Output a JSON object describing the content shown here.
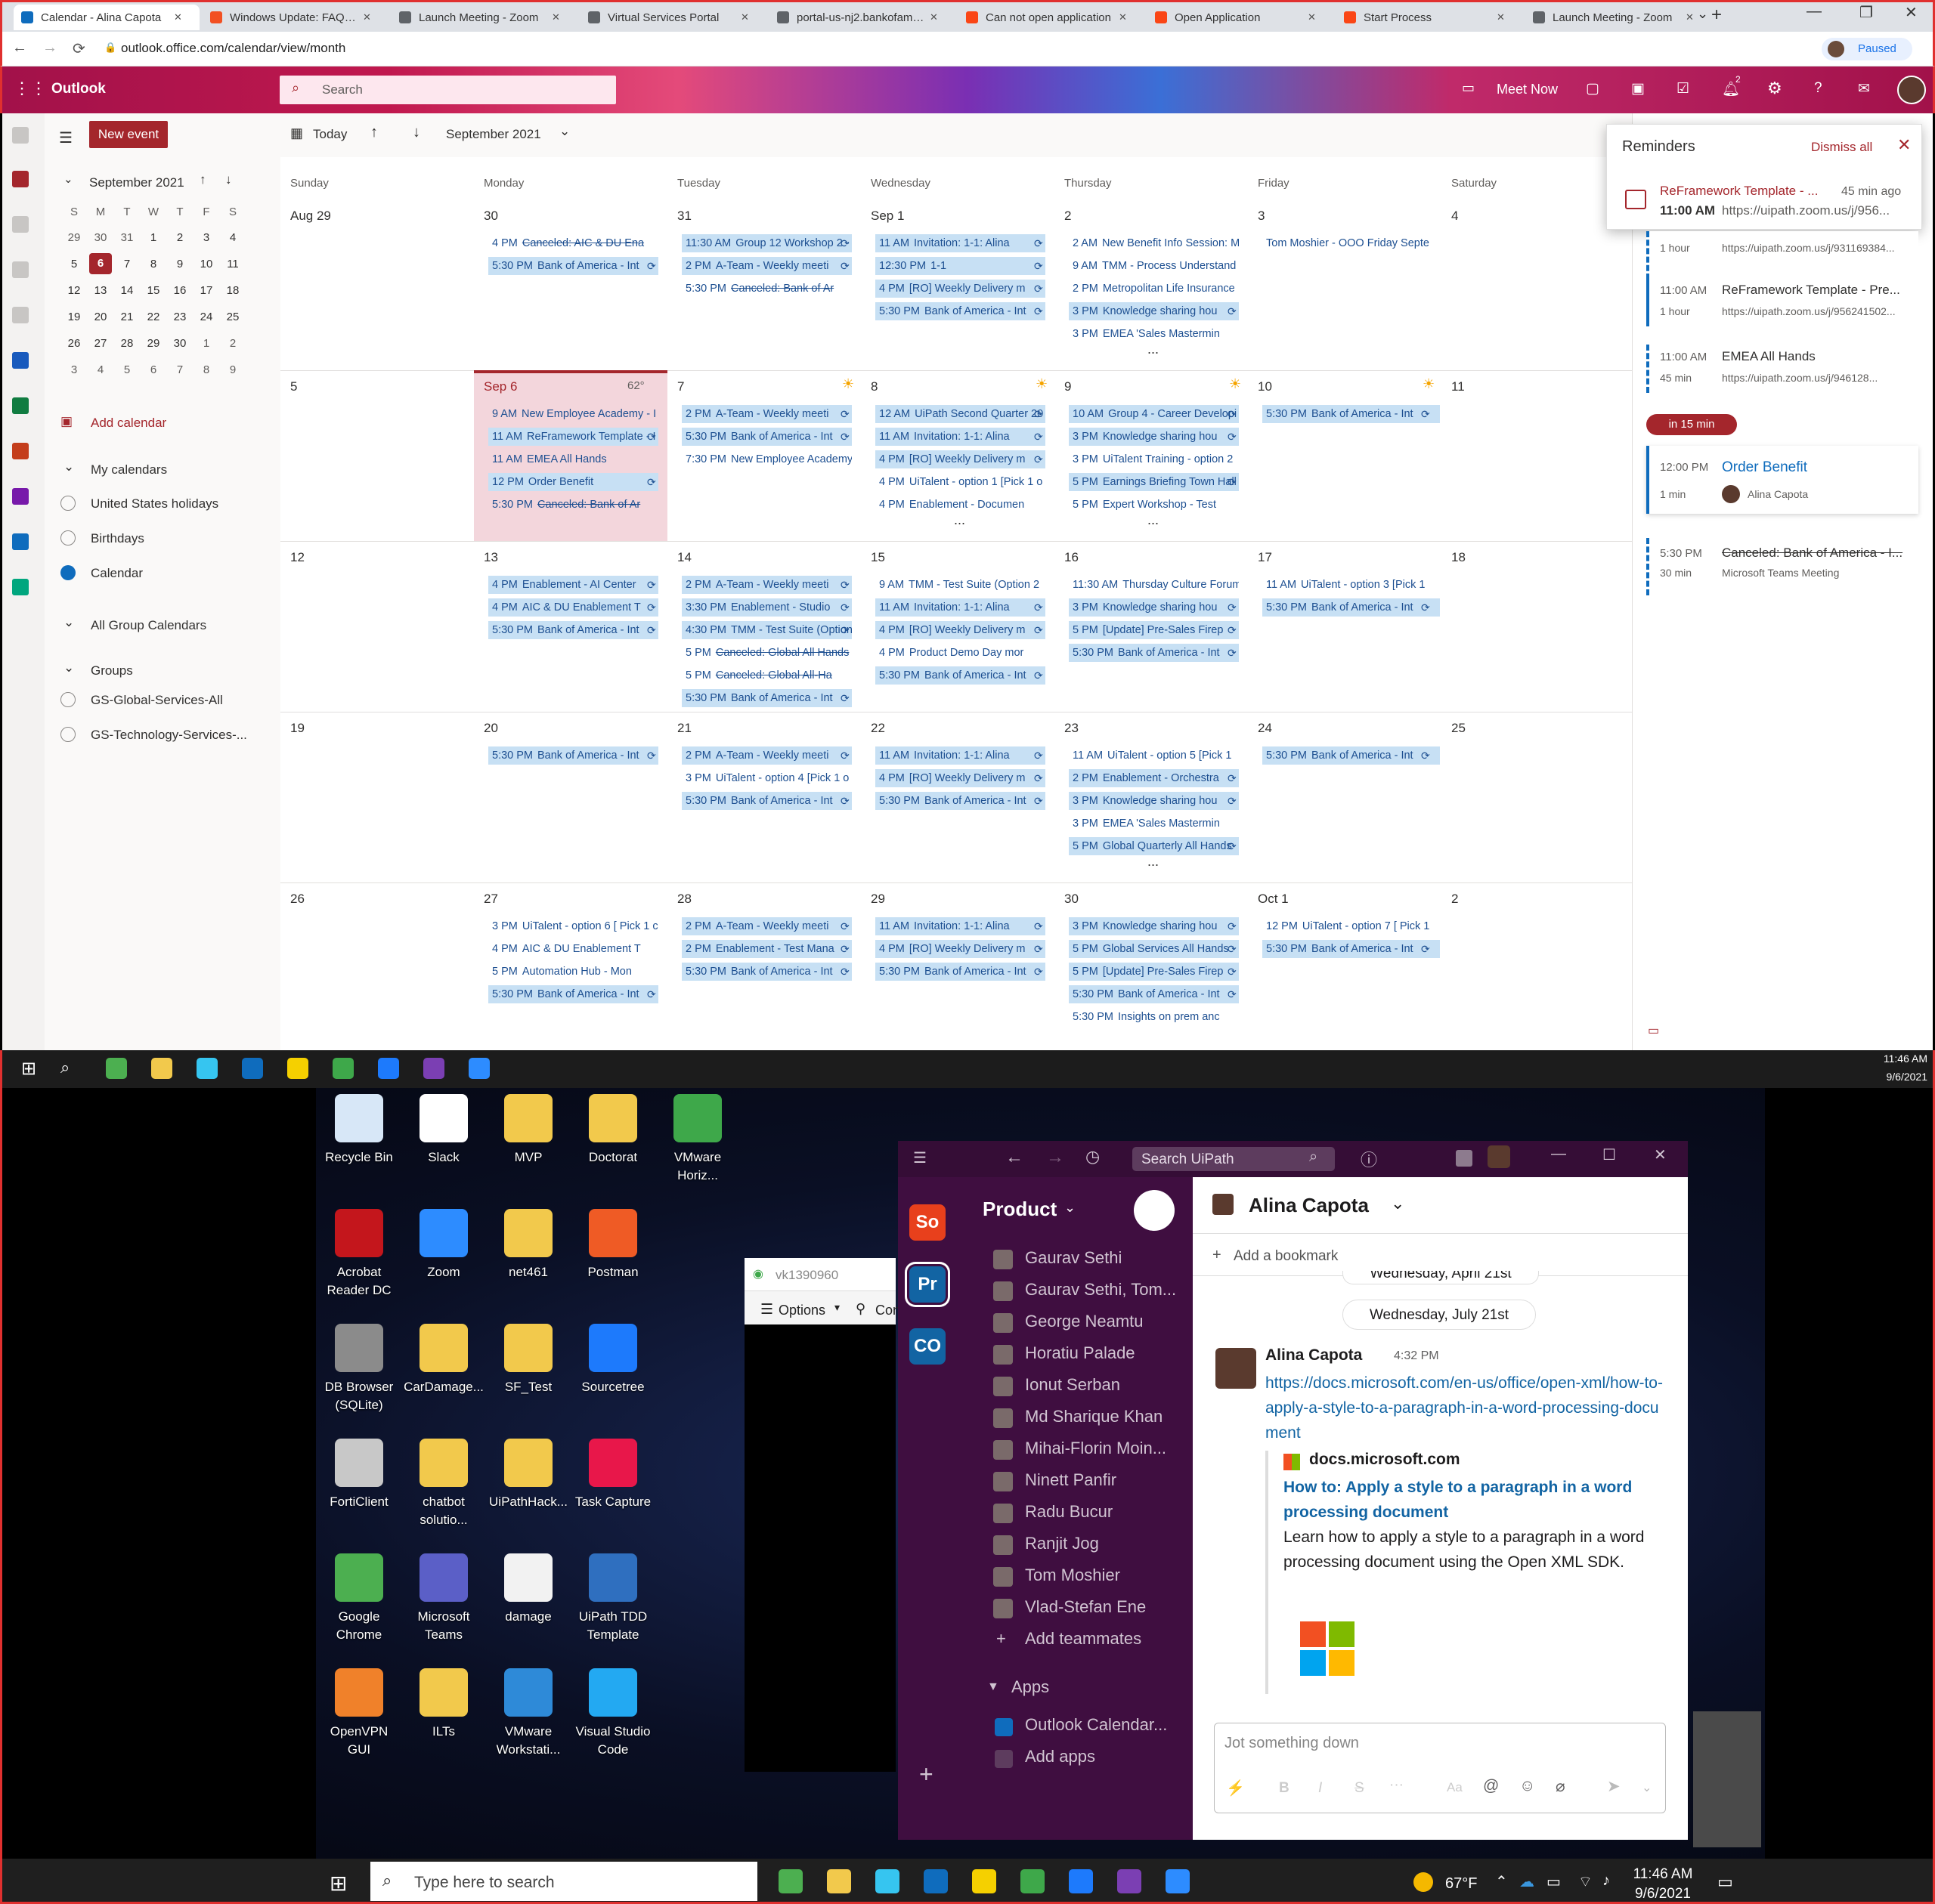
{
  "browser": {
    "tabs": [
      {
        "label": "Calendar - Alina Capota",
        "color": "#0f6cbd"
      },
      {
        "label": "Windows Update: FAQ - Windows",
        "color": "#f25022"
      },
      {
        "label": "Launch Meeting - Zoom",
        "color": "#5f6368"
      },
      {
        "label": "Virtual Services Portal",
        "color": "#5f6368"
      },
      {
        "label": "portal-us-nj2.bankofamerica",
        "color": "#5f6368"
      },
      {
        "label": "Can not open application",
        "color": "#fa4616"
      },
      {
        "label": "Open Application",
        "color": "#fa4616"
      },
      {
        "label": "Start Process",
        "color": "#fa4616"
      },
      {
        "label": "Launch Meeting - Zoom",
        "color": "#5f6368"
      }
    ],
    "url": "outlook.office.com/calendar/view/month",
    "profile_label": "Paused"
  },
  "outlook": {
    "app_name": "Outlook",
    "search_placeholder": "Search",
    "meet_now": "Meet Now",
    "badge_count": "2",
    "new_event": "New event",
    "today": "Today",
    "month_label": "September 2021",
    "accent": "#a4262c"
  },
  "nav": {
    "mini_month": "September 2021",
    "weekday_initials": [
      "S",
      "M",
      "T",
      "W",
      "T",
      "F",
      "S"
    ],
    "weeks": [
      [
        "29",
        "30",
        "31",
        "1",
        "2",
        "3",
        "4"
      ],
      [
        "5",
        "6",
        "7",
        "8",
        "9",
        "10",
        "11"
      ],
      [
        "12",
        "13",
        "14",
        "15",
        "16",
        "17",
        "18"
      ],
      [
        "19",
        "20",
        "21",
        "22",
        "23",
        "24",
        "25"
      ],
      [
        "26",
        "27",
        "28",
        "29",
        "30",
        "1",
        "2"
      ],
      [
        "3",
        "4",
        "5",
        "6",
        "7",
        "8",
        "9"
      ]
    ],
    "add_calendar": "Add calendar",
    "my_calendars": "My calendars",
    "calendars": [
      {
        "label": "United States holidays",
        "checked": false
      },
      {
        "label": "Birthdays",
        "checked": false
      },
      {
        "label": "Calendar",
        "checked": true
      }
    ],
    "all_group": "All Group Calendars",
    "groups": "Groups",
    "group_items": [
      "GS-Global-Services-All",
      "GS-Technology-Services-..."
    ]
  },
  "calendar": {
    "days": [
      "Sunday",
      "Monday",
      "Tuesday",
      "Wednesday",
      "Thursday",
      "Friday",
      "Saturday"
    ],
    "weeks": [
      {
        "dates": [
          "Aug 29",
          "30",
          "31",
          "Sep 1",
          "2",
          "3",
          "4"
        ],
        "events": [
          [],
          [
            {
              "t": "4 PM",
              "n": "Canceled: AIC & DU Ena",
              "s": 1
            },
            {
              "t": "5:30 PM",
              "n": "Bank of America - Int",
              "b": 1
            }
          ],
          [
            {
              "t": "11:30 AM",
              "n": "Group 12 Workshop 2 -",
              "b": 1
            },
            {
              "t": "2 PM",
              "n": "A-Team - Weekly meeti",
              "b": 1
            },
            {
              "t": "5:30 PM",
              "n": "Canceled: Bank of Ar",
              "s": 1
            }
          ],
          [
            {
              "t": "11 AM",
              "n": "Invitation: 1-1: Alina",
              "b": 1
            },
            {
              "t": "12:30 PM",
              "n": "1-1",
              "b": 1
            },
            {
              "t": "4 PM",
              "n": "[RO] Weekly Delivery m",
              "b": 1
            },
            {
              "t": "5:30 PM",
              "n": "Bank of America - Int",
              "b": 1
            }
          ],
          [
            {
              "t": "2 AM",
              "n": "New Benefit Info Session: M"
            },
            {
              "t": "9 AM",
              "n": "TMM - Process Understand"
            },
            {
              "t": "2 PM",
              "n": "Metropolitan Life Insurance"
            },
            {
              "t": "3 PM",
              "n": "Knowledge sharing hou",
              "b": 1
            },
            {
              "t": "3 PM",
              "n": "EMEA 'Sales Mastermin"
            }
          ],
          [
            {
              "t": "",
              "n": "Tom Moshier - OOO Friday Septe"
            }
          ],
          []
        ],
        "more": [
          "",
          "",
          "",
          "",
          "...",
          "",
          ""
        ]
      },
      {
        "dates": [
          "5",
          "Sep 6",
          "7",
          "8",
          "9",
          "10",
          "11"
        ],
        "weather": [
          "",
          "62°",
          "",
          "",
          "",
          "",
          ""
        ],
        "events": [
          [],
          [
            {
              "t": "9 AM",
              "n": "New Employee Academy - I"
            },
            {
              "t": "11 AM",
              "n": "ReFramework Template - I",
              "b": 1
            },
            {
              "t": "11 AM",
              "n": "EMEA All Hands"
            },
            {
              "t": "12 PM",
              "n": "Order Benefit",
              "b": 1
            },
            {
              "t": "5:30 PM",
              "n": "Canceled: Bank of Ar",
              "s": 1
            }
          ],
          [
            {
              "t": "2 PM",
              "n": "A-Team - Weekly meeti",
              "b": 1
            },
            {
              "t": "5:30 PM",
              "n": "Bank of America - Int",
              "b": 1
            },
            {
              "t": "7:30 PM",
              "n": "New Employee Academy"
            }
          ],
          [
            {
              "t": "12 AM",
              "n": "UiPath Second Quarter 20",
              "b": 1
            },
            {
              "t": "11 AM",
              "n": "Invitation: 1-1: Alina",
              "b": 1
            },
            {
              "t": "4 PM",
              "n": "[RO] Weekly Delivery m",
              "b": 1
            },
            {
              "t": "4 PM",
              "n": "UiTalent - option 1 [Pick 1 o"
            },
            {
              "t": "4 PM",
              "n": "Enablement - Documen"
            }
          ],
          [
            {
              "t": "10 AM",
              "n": "Group 4 - Career Developi",
              "b": 1
            },
            {
              "t": "3 PM",
              "n": "Knowledge sharing hou",
              "b": 1
            },
            {
              "t": "3 PM",
              "n": "UiTalent Training - option 2"
            },
            {
              "t": "5 PM",
              "n": "Earnings Briefing Town Hall",
              "b": 1
            },
            {
              "t": "5 PM",
              "n": "Expert Workshop - Test"
            }
          ],
          [
            {
              "t": "5:30 PM",
              "n": "Bank of America - Int",
              "b": 1
            }
          ],
          []
        ],
        "more": [
          "",
          "",
          "",
          "...",
          "...",
          "",
          ""
        ]
      },
      {
        "dates": [
          "12",
          "13",
          "14",
          "15",
          "16",
          "17",
          "18"
        ],
        "events": [
          [],
          [
            {
              "t": "4 PM",
              "n": "Enablement - AI Center",
              "b": 1
            },
            {
              "t": "4 PM",
              "n": "AIC & DU Enablement T",
              "b": 1
            },
            {
              "t": "5:30 PM",
              "n": "Bank of America - Int",
              "b": 1
            }
          ],
          [
            {
              "t": "2 PM",
              "n": "A-Team - Weekly meeti",
              "b": 1
            },
            {
              "t": "3:30 PM",
              "n": "Enablement - Studio",
              "b": 1
            },
            {
              "t": "4:30 PM",
              "n": "TMM - Test Suite (Option",
              "b": 1
            },
            {
              "t": "5 PM",
              "n": "Canceled: Global All Hands",
              "s": 1
            },
            {
              "t": "5 PM",
              "n": "Canceled: Global All-Ha",
              "s": 1
            },
            {
              "t": "5:30 PM",
              "n": "Bank of America - Int",
              "b": 1
            }
          ],
          [
            {
              "t": "9 AM",
              "n": "TMM - Test Suite (Option 2"
            },
            {
              "t": "11 AM",
              "n": "Invitation: 1-1: Alina",
              "b": 1
            },
            {
              "t": "4 PM",
              "n": "[RO] Weekly Delivery m",
              "b": 1
            },
            {
              "t": "4 PM",
              "n": "Product Demo Day mor"
            },
            {
              "t": "5:30 PM",
              "n": "Bank of America - Int",
              "b": 1
            }
          ],
          [
            {
              "t": "11:30 AM",
              "n": "Thursday Culture Forum"
            },
            {
              "t": "3 PM",
              "n": "Knowledge sharing hou",
              "b": 1
            },
            {
              "t": "5 PM",
              "n": "[Update] Pre-Sales Firep",
              "b": 1
            },
            {
              "t": "5:30 PM",
              "n": "Bank of America - Int",
              "b": 1
            }
          ],
          [
            {
              "t": "11 AM",
              "n": "UiTalent - option 3 [Pick 1"
            },
            {
              "t": "5:30 PM",
              "n": "Bank of America - Int",
              "b": 1
            }
          ],
          []
        ],
        "more": [
          "",
          "",
          "",
          "",
          "",
          "",
          ""
        ]
      },
      {
        "dates": [
          "19",
          "20",
          "21",
          "22",
          "23",
          "24",
          "25"
        ],
        "events": [
          [],
          [
            {
              "t": "5:30 PM",
              "n": "Bank of America - Int",
              "b": 1
            }
          ],
          [
            {
              "t": "2 PM",
              "n": "A-Team - Weekly meeti",
              "b": 1
            },
            {
              "t": "3 PM",
              "n": "UiTalent - option 4 [Pick 1 o"
            },
            {
              "t": "5:30 PM",
              "n": "Bank of America - Int",
              "b": 1
            }
          ],
          [
            {
              "t": "11 AM",
              "n": "Invitation: 1-1: Alina",
              "b": 1
            },
            {
              "t": "4 PM",
              "n": "[RO] Weekly Delivery m",
              "b": 1
            },
            {
              "t": "5:30 PM",
              "n": "Bank of America - Int",
              "b": 1
            }
          ],
          [
            {
              "t": "11 AM",
              "n": "UiTalent - option 5 [Pick 1"
            },
            {
              "t": "2 PM",
              "n": "Enablement - Orchestra",
              "b": 1
            },
            {
              "t": "3 PM",
              "n": "Knowledge sharing hou",
              "b": 1
            },
            {
              "t": "3 PM",
              "n": "EMEA 'Sales Mastermin"
            },
            {
              "t": "5 PM",
              "n": "Global Quarterly All Hands",
              "b": 1
            }
          ],
          [
            {
              "t": "5:30 PM",
              "n": "Bank of America - Int",
              "b": 1
            }
          ],
          []
        ],
        "more": [
          "",
          "",
          "",
          "",
          "...",
          "",
          ""
        ]
      },
      {
        "dates": [
          "26",
          "27",
          "28",
          "29",
          "30",
          "Oct 1",
          "2"
        ],
        "events": [
          [],
          [
            {
              "t": "3 PM",
              "n": "UiTalent - option 6 [ Pick 1 c"
            },
            {
              "t": "4 PM",
              "n": "AIC & DU Enablement T"
            },
            {
              "t": "5 PM",
              "n": "Automation Hub - Mon"
            },
            {
              "t": "5:30 PM",
              "n": "Bank of America - Int",
              "b": 1
            }
          ],
          [
            {
              "t": "2 PM",
              "n": "A-Team - Weekly meeti",
              "b": 1
            },
            {
              "t": "2 PM",
              "n": "Enablement - Test Mana",
              "b": 1
            },
            {
              "t": "5:30 PM",
              "n": "Bank of America - Int",
              "b": 1
            }
          ],
          [
            {
              "t": "11 AM",
              "n": "Invitation: 1-1: Alina",
              "b": 1
            },
            {
              "t": "4 PM",
              "n": "[RO] Weekly Delivery m",
              "b": 1
            },
            {
              "t": "5:30 PM",
              "n": "Bank of America - Int",
              "b": 1
            }
          ],
          [
            {
              "t": "3 PM",
              "n": "Knowledge sharing hou",
              "b": 1
            },
            {
              "t": "5 PM",
              "n": "Global Services All Hands",
              "b": 1
            },
            {
              "t": "5 PM",
              "n": "[Update] Pre-Sales Firep",
              "b": 1
            },
            {
              "t": "5:30 PM",
              "n": "Bank of America - Int",
              "b": 1
            },
            {
              "t": "5:30 PM",
              "n": "Insights on prem anc"
            }
          ],
          [
            {
              "t": "12 PM",
              "n": "UiTalent - option 7 [ Pick 1"
            },
            {
              "t": "5:30 PM",
              "n": "Bank of America - Int",
              "b": 1
            }
          ],
          []
        ],
        "more": [
          "",
          "",
          "",
          "",
          "",
          "",
          ""
        ]
      }
    ]
  },
  "reminders": {
    "title": "Reminders",
    "dismiss_all": "Dismiss all",
    "item_title": "ReFramework Template - ...",
    "item_ago": "45 min ago",
    "item_time": "11:00 AM",
    "item_link": "https://uipath.zoom.us/j/956..."
  },
  "agenda": {
    "items": [
      {
        "time": "",
        "dur": "1 hour",
        "title": "",
        "sub": "https://uipath.zoom.us/j/931169384..."
      },
      {
        "time": "11:00 AM",
        "dur": "1 hour",
        "title": "ReFramework Template - Pre...",
        "sub": "https://uipath.zoom.us/j/956241502..."
      },
      {
        "time": "11:00 AM",
        "dur": "45 min",
        "title": "EMEA All Hands",
        "sub": "https://uipath.zoom.us/j/946128..."
      }
    ],
    "pill": "in 15 min",
    "order": {
      "time": "12:00 PM",
      "dur": "1 min",
      "title": "Order Benefit",
      "person": "Alina Capota"
    },
    "canceled": {
      "time": "5:30 PM",
      "dur": "30 min",
      "title": "Canceled: Bank of America - I...",
      "sub": "Microsoft Teams Meeting"
    }
  },
  "taskbar_top": {
    "time": "11:46 AM",
    "date": "9/6/2021"
  },
  "desktop": {
    "icons": [
      {
        "label": "Recycle Bin",
        "color": "#d7e7f7"
      },
      {
        "label": "Slack",
        "color": "#ffffff"
      },
      {
        "label": "MVP",
        "color": "#f2c94c"
      },
      {
        "label": "Doctorat",
        "color": "#f2c94c"
      },
      {
        "label": "VMware Horiz...",
        "color": "#3ea84a"
      },
      {
        "label": "Acrobat Reader DC",
        "color": "#c4161c"
      },
      {
        "label": "Zoom",
        "color": "#2d8cff"
      },
      {
        "label": "net461",
        "color": "#f2c94c"
      },
      {
        "label": "Postman",
        "color": "#ef5b25"
      },
      {
        "label": "DB Browser (SQLite)",
        "color": "#8b8b8b"
      },
      {
        "label": "CarDamage...",
        "color": "#f2c94c"
      },
      {
        "label": "SF_Test",
        "color": "#f2c94c"
      },
      {
        "label": "Sourcetree",
        "color": "#1d7afc"
      },
      {
        "label": "FortiClient",
        "color": "#c8c8c8"
      },
      {
        "label": "chatbot solutio...",
        "color": "#f2c94c"
      },
      {
        "label": "UiPathHack...",
        "color": "#f2c94c"
      },
      {
        "label": "Task Capture",
        "color": "#e8174a"
      },
      {
        "label": "Google Chrome",
        "color": "#4caf50"
      },
      {
        "label": "Microsoft Teams",
        "color": "#5b5fc7"
      },
      {
        "label": "damage",
        "color": "#f2f2f2"
      },
      {
        "label": "UiPath TDD Template",
        "color": "#2f6fbf"
      },
      {
        "label": "OpenVPN GUI",
        "color": "#f0812a"
      },
      {
        "label": "ILTs",
        "color": "#f2c94c"
      },
      {
        "label": "VMware Workstati...",
        "color": "#2e8ad8"
      },
      {
        "label": "Visual Studio Code",
        "color": "#23a9f2"
      }
    ],
    "vm_title": "vk1390960",
    "vm_options": "Options",
    "vm_con": "Con"
  },
  "slack": {
    "search": "Search UiPath",
    "workspaces": [
      "So",
      "Pr",
      "CO"
    ],
    "workspace_colors": [
      "#e8401c",
      "#1264a3",
      "#1264a3"
    ],
    "workspace_name": "Product",
    "channels": [
      "Gaurav Sethi",
      "Gaurav Sethi, Tom...",
      "George Neamtu",
      "Horatiu Palade",
      "Ionut Serban",
      "Md Sharique Khan",
      "Mihai-Florin Moin...",
      "Ninett Panfir",
      "Radu Bucur",
      "Ranjit Jog",
      "Tom Moshier",
      "Vlad-Stefan Ene"
    ],
    "add_teammates": "Add teammates",
    "apps_header": "Apps",
    "apps": [
      "Outlook Calendar...",
      "Add apps"
    ],
    "dm_name": "Alina Capota",
    "add_bookmark": "Add a bookmark",
    "date_prev": "Wednesday, April 21st",
    "date_pill": "Wednesday, July 21st",
    "msg_author": "Alina Capota",
    "msg_time": "4:32 PM",
    "msg_link": "https://docs.microsoft.com/en-us/office/open-xml/how-to-apply-a-style-to-a-paragraph-in-a-word-processing-document",
    "unfurl_site": "docs.microsoft.com",
    "unfurl_title": "How to: Apply a style to a paragraph in a word processing document",
    "unfurl_desc": "Learn how to apply a style to a paragraph in a word processing document using the Open XML SDK.",
    "composer_placeholder": "Jot something down"
  },
  "taskbar": {
    "search_placeholder": "Type here to search",
    "temp": "67°F",
    "time": "11:46 AM",
    "date": "9/6/2021"
  }
}
